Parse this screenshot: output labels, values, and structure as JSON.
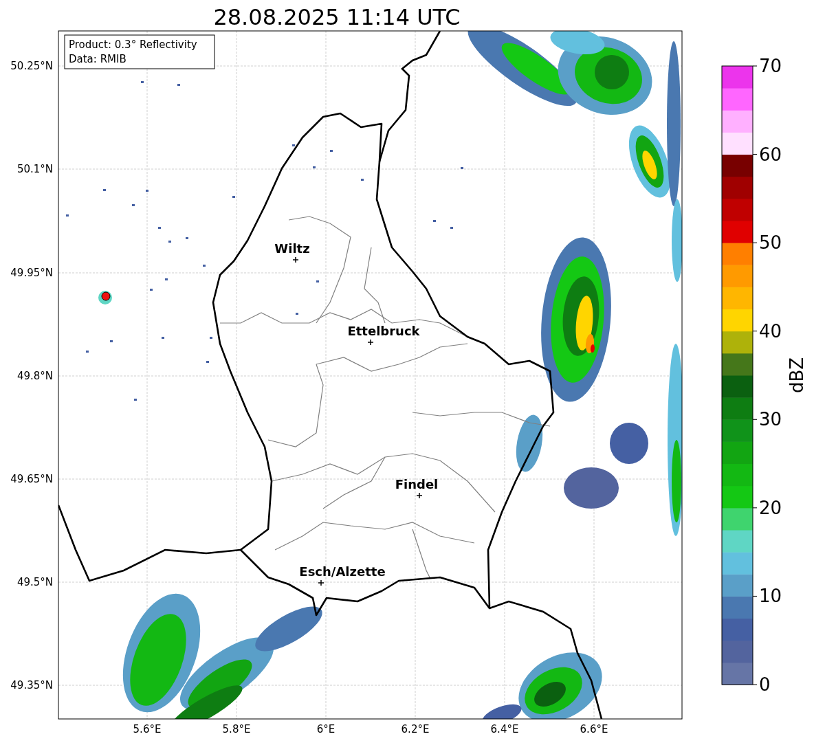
{
  "title": "28.08.2025 11:14 UTC",
  "info_box": {
    "lines": [
      "Product: 0.3° Reflectivity",
      "Data: RMIB"
    ]
  },
  "map": {
    "lat_ticks": [
      "50.25°N",
      "50.1°N",
      "49.95°N",
      "49.8°N",
      "49.65°N",
      "49.5°N",
      "49.35°N"
    ],
    "lon_ticks": [
      "5.6°E",
      "5.8°E",
      "6°E",
      "6.2°E",
      "6.4°E",
      "6.6°E"
    ],
    "places": [
      {
        "name": "Wiltz"
      },
      {
        "name": "Ettelbruck"
      },
      {
        "name": "Findel"
      },
      {
        "name": "Esch/Alzette"
      }
    ]
  },
  "colorbar": {
    "label": "dBZ",
    "ticks": [
      "70",
      "60",
      "50",
      "40",
      "30",
      "20",
      "10",
      "0"
    ],
    "bands": [
      {
        "color": "#6675a6"
      },
      {
        "color": "#53649e"
      },
      {
        "color": "#4560a3"
      },
      {
        "color": "#4a78b0"
      },
      {
        "color": "#5a9fc8"
      },
      {
        "color": "#62c0de"
      },
      {
        "color": "#5fd6c4"
      },
      {
        "color": "#3fd46e"
      },
      {
        "color": "#14c814"
      },
      {
        "color": "#13b813"
      },
      {
        "color": "#12a512"
      },
      {
        "color": "#10931a"
      },
      {
        "color": "#0e7d12"
      },
      {
        "color": "#0b6010"
      },
      {
        "color": "#45771a"
      },
      {
        "color": "#aeb20a"
      },
      {
        "color": "#ffd500"
      },
      {
        "color": "#ffb600"
      },
      {
        "color": "#ff9a00"
      },
      {
        "color": "#ff7f00"
      },
      {
        "color": "#e00000"
      },
      {
        "color": "#c00000"
      },
      {
        "color": "#a00000"
      },
      {
        "color": "#780000"
      },
      {
        "color": "#ffe0ff"
      },
      {
        "color": "#ffb0ff"
      },
      {
        "color": "#ff66ff"
      },
      {
        "color": "#ec34ec"
      }
    ]
  }
}
